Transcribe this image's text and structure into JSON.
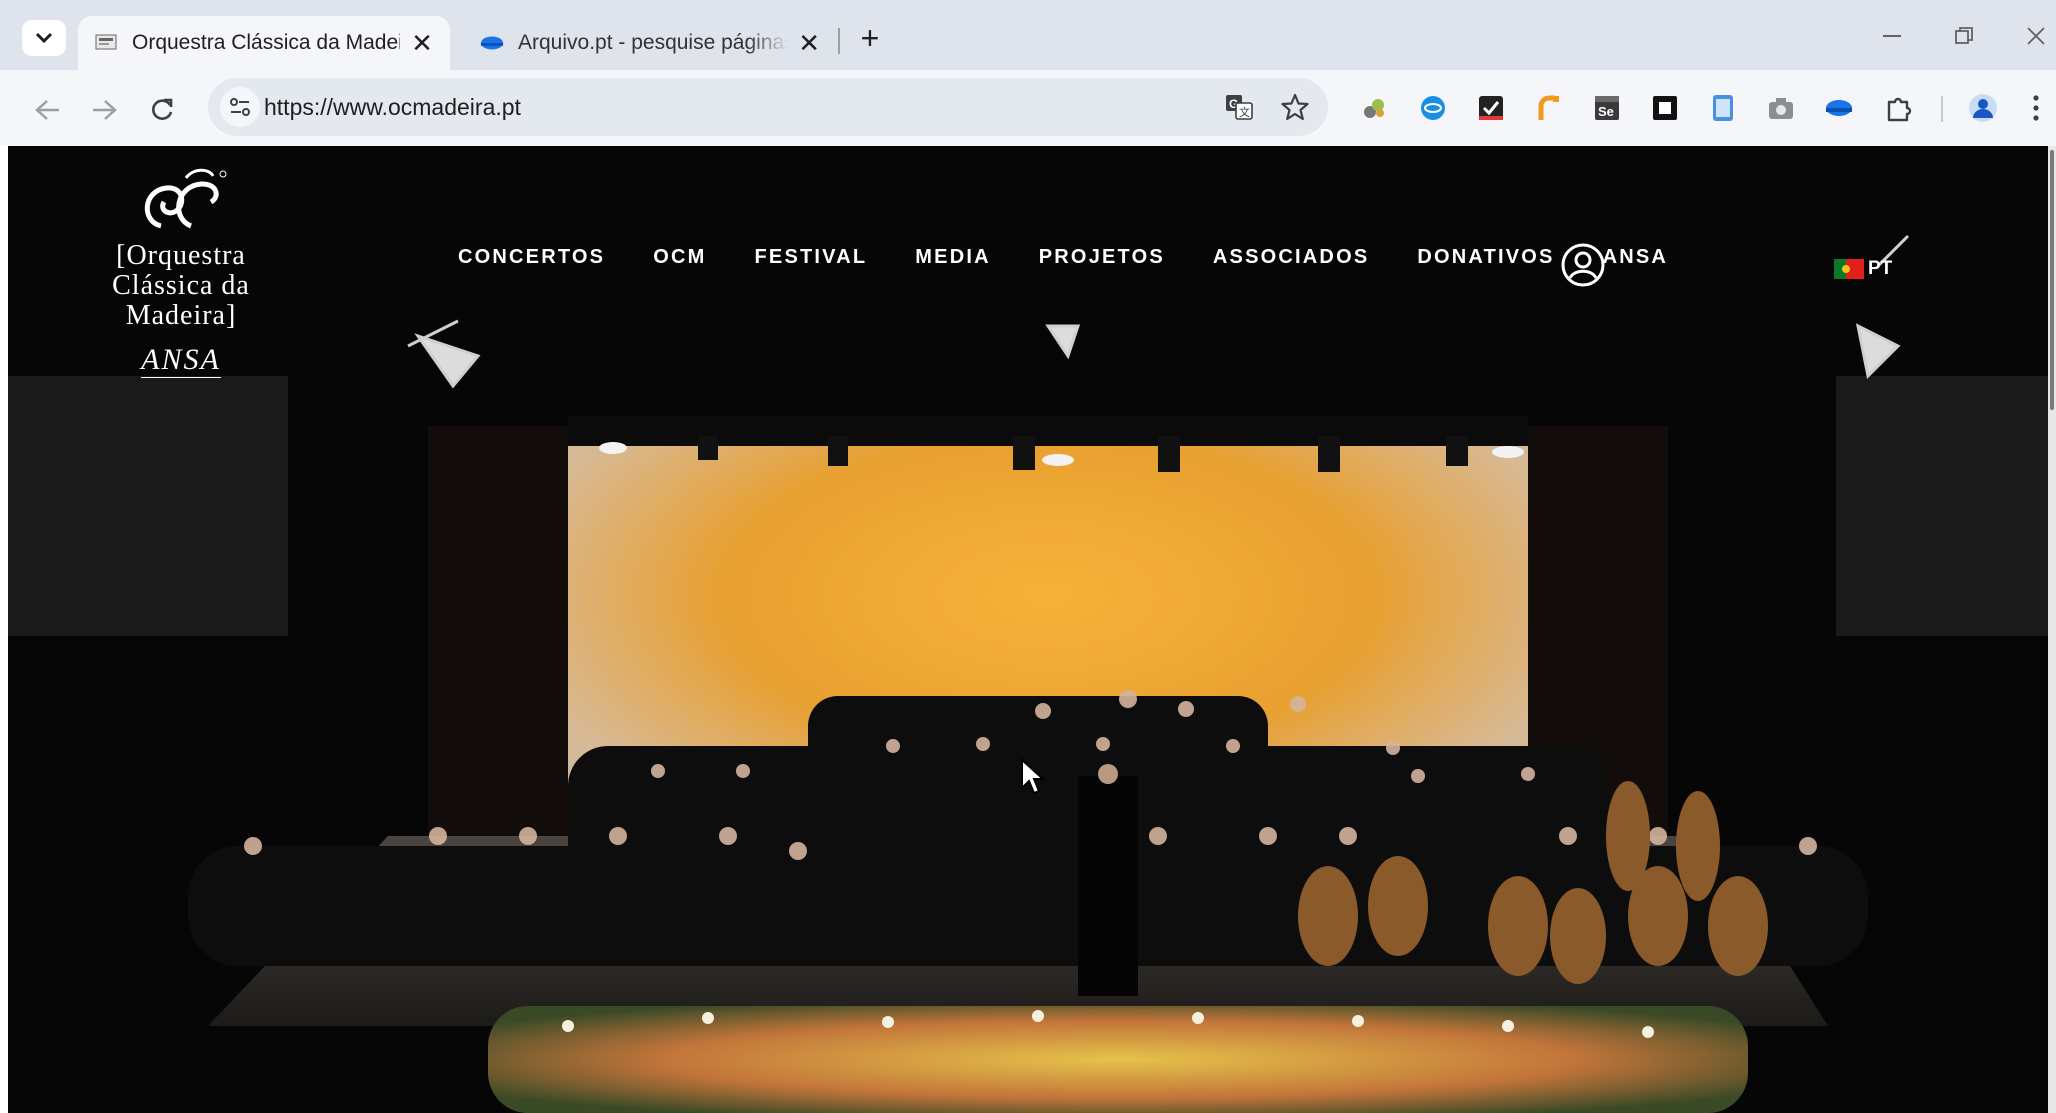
{
  "browser": {
    "tabs": [
      {
        "title": "Orquestra Clássica da Madeira",
        "favicon": "ocm-favicon-icon",
        "active": true
      },
      {
        "title": "Arquivo.pt - pesquise páginas do passado",
        "favicon": "arquivo-favicon-icon",
        "active": false
      }
    ],
    "close_glyph": "✕",
    "new_tab_glyph": "+",
    "url": "https://www.ocmadeira.pt",
    "extensions": [
      "extension-1-icon",
      "extension-2-icon",
      "extension-3-icon",
      "extension-4-icon",
      "selenium-icon",
      "extension-6-icon",
      "extension-7-icon",
      "camera-icon",
      "extension-9-icon",
      "puzzle-icon"
    ]
  },
  "site": {
    "logo": {
      "line1": "[Orquestra",
      "line2": "Clássica da",
      "line3": "Madeira]",
      "sub": "ANSA"
    },
    "nav": [
      "CONCERTOS",
      "OCM",
      "FESTIVAL",
      "MEDIA",
      "PROJETOS",
      "ASSOCIADOS",
      "DONATIVOS",
      "ANSA"
    ],
    "language": "PT"
  },
  "colors": {
    "chrome_tabbar": "#dfe3eb",
    "chrome_toolbar": "#f4f6fa",
    "stage_glow": "#f5a623"
  }
}
